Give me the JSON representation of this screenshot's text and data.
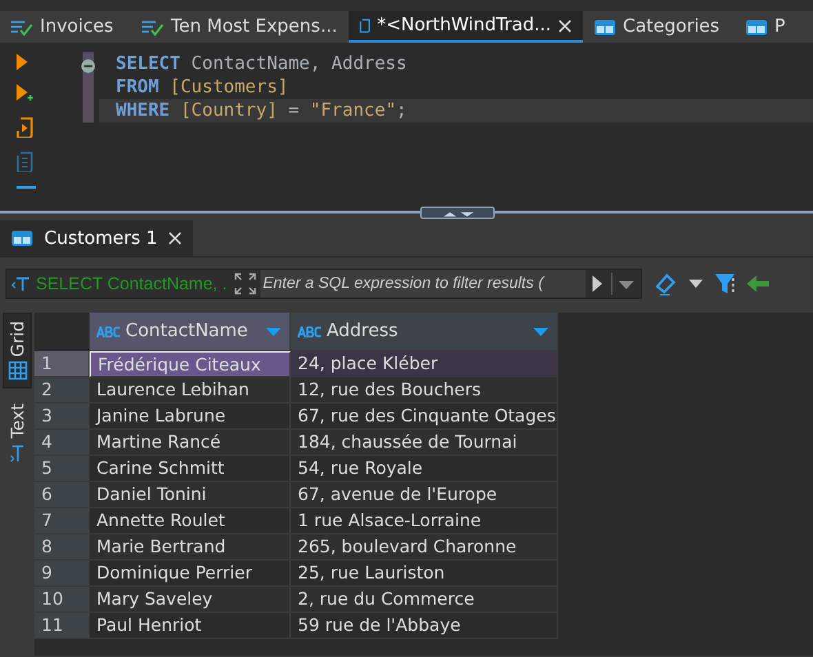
{
  "editor_tabs": [
    {
      "label": "Invoices",
      "kind": "query",
      "selected": false,
      "closable": false
    },
    {
      "label": "Ten Most Expens...",
      "kind": "query",
      "selected": false,
      "closable": false
    },
    {
      "label": "*<NorthWindTrad...",
      "kind": "script",
      "selected": true,
      "closable": true
    },
    {
      "label": "Categories",
      "kind": "table",
      "selected": false,
      "closable": false
    },
    {
      "label": "P",
      "kind": "table",
      "selected": false,
      "closable": false
    }
  ],
  "sql_lines": [
    {
      "current": false,
      "tokens": [
        {
          "kind": "keyword",
          "text": "SELECT"
        },
        {
          "kind": "ident",
          "text": " ContactName, Address"
        }
      ]
    },
    {
      "current": false,
      "tokens": [
        {
          "kind": "keyword",
          "text": "FROM"
        },
        {
          "kind": "quoted",
          "text": " [Customers]"
        }
      ]
    },
    {
      "current": true,
      "tokens": [
        {
          "kind": "keyword",
          "text": "WHERE"
        },
        {
          "kind": "quoted",
          "text": " [Country]"
        },
        {
          "kind": "ident",
          "text": " = "
        },
        {
          "kind": "quoted",
          "text": "\"France\""
        },
        {
          "kind": "ident",
          "text": ";"
        }
      ]
    }
  ],
  "results_tab": {
    "label": "Customers 1"
  },
  "filter": {
    "query": "SELECT ContactName, .",
    "placeholder": "Enter a SQL expression to filter results ("
  },
  "view_tabs": [
    {
      "label": "Grid",
      "kind": "grid",
      "selected": true
    },
    {
      "label": "Text",
      "kind": "text",
      "selected": false
    }
  ],
  "table": {
    "columns": [
      {
        "label": "ContactName",
        "selected": true
      },
      {
        "label": "Address",
        "selected": false
      }
    ],
    "rows": [
      {
        "number": "1",
        "selected": true,
        "cells": [
          "Frédérique Citeaux",
          "24, place Kléber"
        ]
      },
      {
        "number": "2",
        "selected": false,
        "cells": [
          "Laurence Lebihan",
          "12, rue des Bouchers"
        ]
      },
      {
        "number": "3",
        "selected": false,
        "cells": [
          "Janine Labrune",
          "67, rue des Cinquante Otages"
        ]
      },
      {
        "number": "4",
        "selected": false,
        "cells": [
          "Martine Rancé",
          "184, chaussée de Tournai"
        ]
      },
      {
        "number": "5",
        "selected": false,
        "cells": [
          "Carine Schmitt",
          "54, rue Royale"
        ]
      },
      {
        "number": "6",
        "selected": false,
        "cells": [
          "Daniel Tonini",
          "67, avenue de l'Europe"
        ]
      },
      {
        "number": "7",
        "selected": false,
        "cells": [
          "Annette Roulet",
          "1 rue Alsace-Lorraine"
        ]
      },
      {
        "number": "8",
        "selected": false,
        "cells": [
          "Marie Bertrand",
          "265, boulevard Charonne"
        ]
      },
      {
        "number": "9",
        "selected": false,
        "cells": [
          "Dominique Perrier",
          "25, rue Lauriston"
        ]
      },
      {
        "number": "10",
        "selected": false,
        "cells": [
          "Mary Saveley",
          "2, rue du Commerce"
        ]
      },
      {
        "number": "11",
        "selected": false,
        "cells": [
          "Paul Henriot",
          "59 rue de l'Abbaye"
        ]
      }
    ]
  }
}
